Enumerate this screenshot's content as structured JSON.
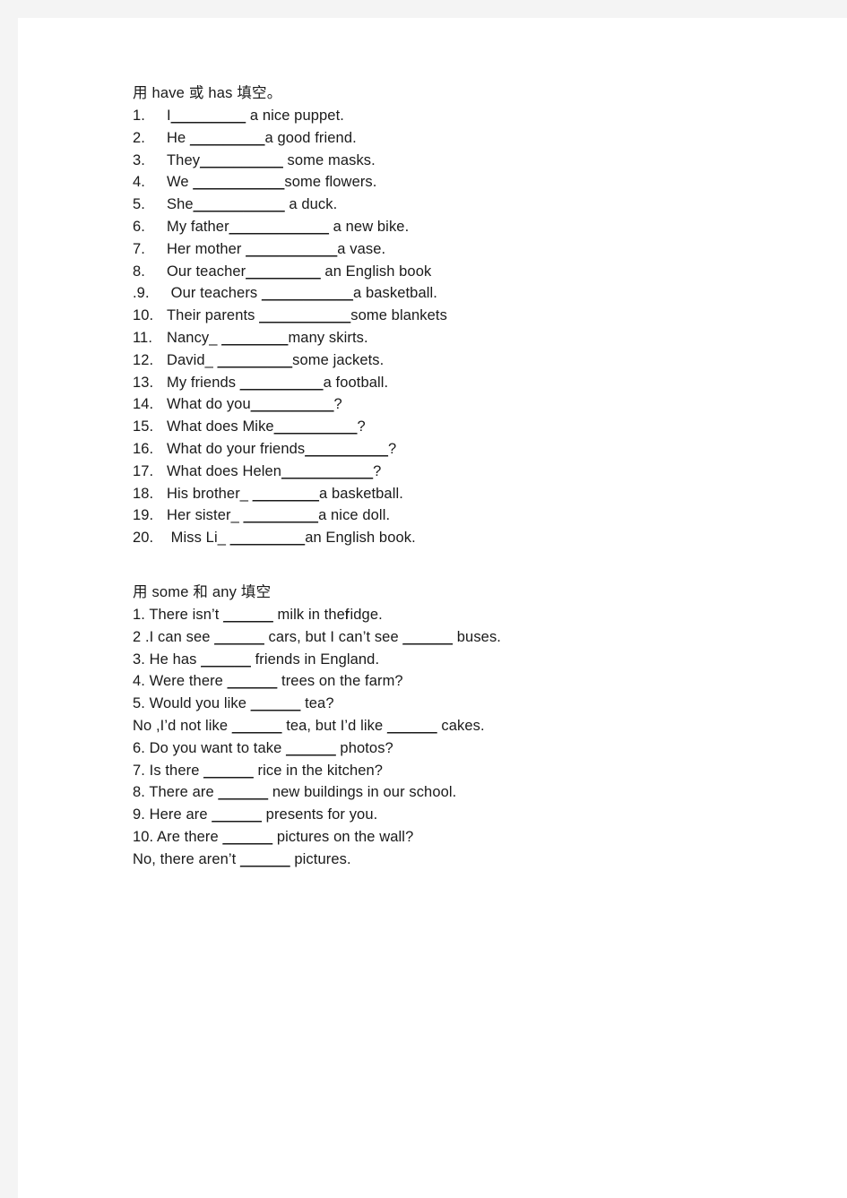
{
  "page": {
    "background_color": "#f4f4f4",
    "paper_color": "#ffffff",
    "text_color": "#1a1a1a"
  },
  "section1": {
    "title_part1": "用",
    "title_part2": " have ",
    "title_part3": "或",
    "title_part4": " has ",
    "title_part5": "填空。",
    "title_full": "用 have 或 has 填空。",
    "items": [
      {
        "num": "1.",
        "pre": "I",
        "blank": "_________",
        "post": " a nice puppet."
      },
      {
        "num": "2.",
        "pre": "He ",
        "blank": "_________",
        "post": "a good friend."
      },
      {
        "num": "3.",
        "pre": "They",
        "blank": "__________",
        "post": " some masks."
      },
      {
        "num": "4.",
        "pre": "We ",
        "blank": "___________",
        "post": "some flowers."
      },
      {
        "num": "5.",
        "pre": "She",
        "blank": "___________",
        "post": " a duck."
      },
      {
        "num": "6.",
        "pre": "My father",
        "blank": "____________",
        "post": " a new bike."
      },
      {
        "num": "7.",
        "pre": "Her mother ",
        "blank": "___________",
        "post": "a vase."
      },
      {
        "num": "8.",
        "pre": "Our teacher",
        "blank": "_________",
        "post": " an English book"
      },
      {
        "num": ".9.",
        "pre": " Our teachers ",
        "blank": "___________",
        "post": "a basketball."
      },
      {
        "num": "10.",
        "pre": "Their parents ",
        "blank": "___________",
        "post": "some blankets"
      },
      {
        "num": "11.",
        "pre": "Nancy_ ",
        "blank": "________",
        "post": "many skirts."
      },
      {
        "num": "12.",
        "pre": "David_ ",
        "blank": "_________",
        "post": "some jackets."
      },
      {
        "num": "13.",
        "pre": "My friends ",
        "blank": "__________",
        "post": "a football."
      },
      {
        "num": "14.",
        "pre": "What do you",
        "blank": "__________",
        "post": "?"
      },
      {
        "num": "15.",
        "pre": "What does Mike",
        "blank": "__________",
        "post": "?"
      },
      {
        "num": "16.",
        "pre": "What do your friends",
        "blank": "__________",
        "post": "?"
      },
      {
        "num": "17.",
        "pre": "What does Helen",
        "blank": "___________",
        "post": "?"
      },
      {
        "num": "18.",
        "pre": "His brother_ ",
        "blank": "________",
        "post": "a basketball."
      },
      {
        "num": "19.",
        "pre": "Her sister_ ",
        "blank": "_________",
        "post": "a nice doll."
      },
      {
        "num": "20.",
        "pre": " Miss Li_ ",
        "blank": "_________",
        "post": "an English book."
      }
    ]
  },
  "section2": {
    "title_full": "用 some 和 any 填空",
    "items": [
      {
        "text_a": "1. There isn’t ",
        "blank1": "______",
        "text_b": " milk in the",
        "overlap": "f",
        "text_c": "ridge.",
        "blank2": "",
        "text_d": ""
      },
      {
        "text_a": "2 .I can see ",
        "blank1": "______",
        "text_b": " cars, but I can’t see ",
        "overlap": "",
        "text_c": "",
        "blank2": "______",
        "text_d": " buses."
      },
      {
        "text_a": "3. He has ",
        "blank1": "______",
        "text_b": " friends in England.",
        "overlap": "",
        "text_c": "",
        "blank2": "",
        "text_d": ""
      },
      {
        "text_a": "4. Were there ",
        "blank1": "______",
        "text_b": " trees on the farm?",
        "overlap": "",
        "text_c": "",
        "blank2": "",
        "text_d": ""
      },
      {
        "text_a": "5. Would you like ",
        "blank1": "______",
        "text_b": " tea?",
        "overlap": "",
        "text_c": "",
        "blank2": "",
        "text_d": ""
      },
      {
        "text_a": "No ,I’d not like ",
        "blank1": "______",
        "text_b": " tea, but I’d like ",
        "overlap": "",
        "text_c": "",
        "blank2": "______",
        "text_d": " cakes."
      },
      {
        "text_a": "6. Do you want to take ",
        "blank1": "______",
        "text_b": " photos?",
        "overlap": "",
        "text_c": "",
        "blank2": "",
        "text_d": ""
      },
      {
        "text_a": "7. Is there ",
        "blank1": "______",
        "text_b": " rice in the kitchen?",
        "overlap": "",
        "text_c": "",
        "blank2": "",
        "text_d": ""
      },
      {
        "text_a": "8. There are ",
        "blank1": "______",
        "text_b": " new buildings in our school.",
        "overlap": "",
        "text_c": "",
        "blank2": "",
        "text_d": ""
      },
      {
        "text_a": "9. Here are ",
        "blank1": "______",
        "text_b": " presents for you.",
        "overlap": "",
        "text_c": "",
        "blank2": "",
        "text_d": ""
      },
      {
        "text_a": "10. Are there ",
        "blank1": "______",
        "text_b": " pictures on the wall?",
        "overlap": "",
        "text_c": "",
        "blank2": "",
        "text_d": ""
      },
      {
        "text_a": "No, there aren’t ",
        "blank1": "______",
        "text_b": " pictures.",
        "overlap": "",
        "text_c": "",
        "blank2": "",
        "text_d": ""
      }
    ]
  }
}
